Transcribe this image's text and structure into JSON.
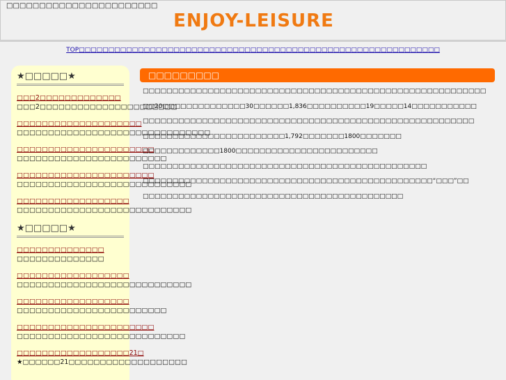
{
  "header": {
    "tagline": "□□□□□□□□□□□□□□□□□□□□□□□",
    "title": "ENJOY-LEISURE"
  },
  "topnav": {
    "link": "TOP□□□□□□□□□□□□□□□□□□□□□□□□□□□□□□□□□□□□□□□□□□□□□□□□□□□□□□□□□□□□□"
  },
  "sidebar": {
    "section1_title": "★□□□□□★",
    "section1_items": [
      {
        "link": "□□□2□□□□□□□□□□□□□",
        "desc": "□□□2□□□□□□□□□□□□□□□□□□□□□□"
      },
      {
        "link": "□□□□□□□□□□□□□□□□□□□□",
        "desc": "□□□□□□□□□□□□□□□□□□□□□□□□□□□□□□□"
      },
      {
        "link": "□□□□□□□□□□□□□□□□□□□□□□",
        "desc": "□□□□□□□□□□□□□□□□□□□□□□□□"
      },
      {
        "link": "□□□□□□□□□□□□□□□□□□□□□□",
        "desc": "□□□□□□□□□□□□□□□□□□□□□□□□□□□□"
      },
      {
        "link": "□□□□□□□□□□□□□□□□□□",
        "desc": "□□□□□□□□□□□□□□□□□□□□□□□□□□□□"
      }
    ],
    "section2_title": "★□□□□□★",
    "section2_items": [
      {
        "link": "□□□□□□□□□□□□□□",
        "desc": "□□□□□□□□□□□□□□"
      },
      {
        "link": "□□□□□□□□□□□□□□□□□□",
        "desc": "□□□□□□□□□□□□□□□□□□□□□□□□□□□□"
      },
      {
        "link": "□□□□□□□□□□□□□□□□□□",
        "desc": "□□□□□□□□□□□□□□□□□□□□□□□□"
      },
      {
        "link": "□□□□□□□□□□□□□□□□□□□□□□",
        "desc": "□□□□□□□□□□□□□□□□□□□□□□□□□□□"
      },
      {
        "link": "□□□□□□□□□□□□□□□□□□21□",
        "desc": "★□□□□□□21□□□□□□□□□□□□□□□□□□□"
      }
    ]
  },
  "main": {
    "heading": "□□□□□□□□□",
    "paragraphs": [
      "□□□□□□□□□□□□□□□□□□□□□□□□□□□□□□□□□□□□□□□□□□□□□□□□□□□□□□□□□□",
      "□□20□□□□□□□□□□□□□□30□□□□□□1,836□□□□□□□□□□19□□□□□14□□□□□□□□□□□",
      "□□□□□□□□□□□□□□□□□□□□□□□□□□□□□□□□□□□□□□□□□□□□□□□□□□□□□□□□",
      "□□□□□□□□□□□□□□□□□□□□□□□□1,792□□□□□□□1800□□□□□□□",
      "□□□□□□□□□□□□□1800□□□□□□□□□□□□□□□□□□□□□□□□",
      "□□□□□□□□□□□□□□□□□□□□□□□□□□□□□□□□□□□□□□□□□□□□□□□□",
      "□□□□□□□□□□□□□□□□□□□□□□□□□□□□□□□□□□□□□□□□□□□□□□□□□“□□□”□□",
      "□□□□□□□□□□□□□□□□□□□□□□□□□□□□□□□□□□□□□□□□□□□□"
    ]
  }
}
